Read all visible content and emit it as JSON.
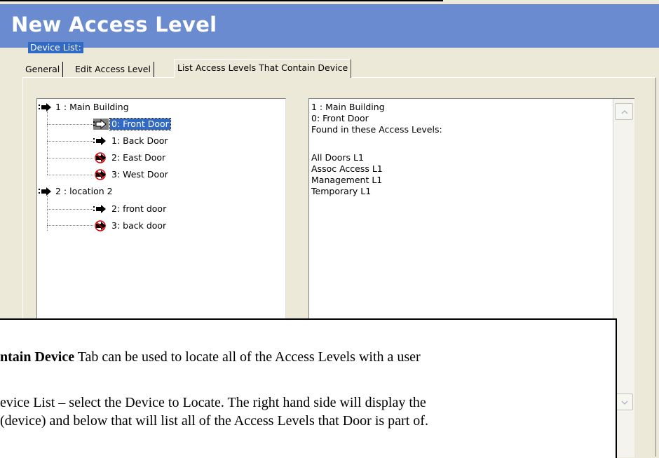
{
  "window": {
    "title": "New Access Level"
  },
  "tabs": [
    {
      "label": "General"
    },
    {
      "label": "Edit Access Level"
    },
    {
      "label": "List Access Levels That Contain Device"
    }
  ],
  "device_list": {
    "label": "Device List:",
    "tree": [
      {
        "label": "1 : Main Building",
        "icon": "arrow-icon",
        "children": [
          {
            "label": "0: Front Door",
            "icon": "arrow-outline-icon",
            "selected": true
          },
          {
            "label": "1: Back Door",
            "icon": "arrow-icon"
          },
          {
            "label": "2: East Door",
            "icon": "arrow-no-entry-icon"
          },
          {
            "label": "3: West Door",
            "icon": "arrow-no-entry-icon"
          }
        ]
      },
      {
        "label": "2 : location 2",
        "icon": "arrow-icon",
        "children": [
          {
            "label": "2: front door",
            "icon": "arrow-icon"
          },
          {
            "label": "3: back door",
            "icon": "arrow-no-entry-icon"
          }
        ]
      }
    ]
  },
  "details": {
    "lines": [
      "1 : Main Building",
      "0: Front Door",
      "Found in these Access Levels:",
      "",
      "All Doors L1",
      "Assoc Access L1",
      "Management L1",
      "Temporary L1"
    ]
  },
  "callout": {
    "line1_bold": "ntain Device",
    "line1_rest": " Tab can be used to locate all of the Access Levels with a user",
    "line2": "evice List – select the Device to Locate. The right hand side will display the",
    "line3": " (device) and below that will list all of the Access Levels that Door is part of."
  },
  "colors": {
    "title_bar": "#6a8bd0",
    "selection": "#316ac5",
    "dialog": "#ece9d8"
  }
}
